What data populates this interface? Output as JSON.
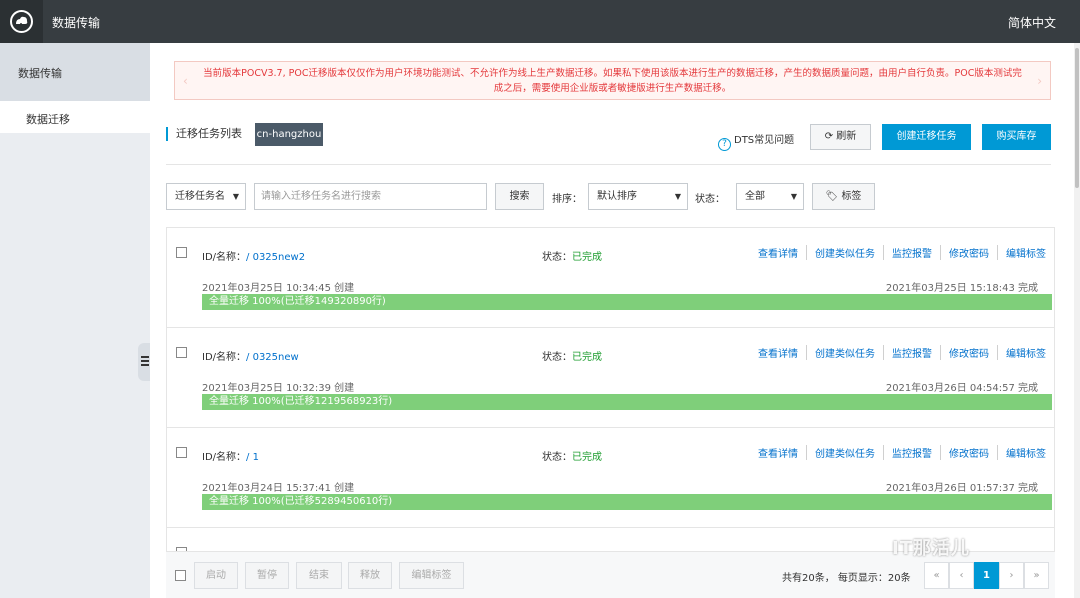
{
  "topbar": {
    "app_title": "数据传输",
    "language": "简体中文",
    "logo_icon": "cloud-logo-icon"
  },
  "sidebar": {
    "section": "数据传输",
    "items": [
      {
        "label": "数据迁移"
      }
    ]
  },
  "notice": {
    "text": "当前版本POCV3.7, POC迁移版本仅仅作为用户环境功能测试、不允许作为线上生产数据迁移。如果私下使用该版本进行生产的数据迁移，产生的数据质量问题，由用户自行负责。POC版本测试完成之后，需要使用企业版或者敏捷版进行生产数据迁移。"
  },
  "header": {
    "list_title": "迁移任务列表",
    "region": "cn-hangzhou",
    "faq": "DTS常见问题",
    "refresh": "刷新",
    "create": "创建迁移任务",
    "buy": "购买库存"
  },
  "filters": {
    "field_select": "迁移任务名",
    "search_placeholder": "请输入迁移任务名进行搜索",
    "search_button": "搜索",
    "sort_label": "排序：",
    "sort_value": "默认排序",
    "status_label": "状态：",
    "status_value": "全部",
    "tag_button": "标签"
  },
  "tasks": [
    {
      "id_label": "ID/名称：",
      "name": "/ 0325new2",
      "status_label": "状态：",
      "status": "已完成",
      "actions": [
        "查看详情",
        "创建类似任务",
        "监控报警",
        "修改密码",
        "编辑标签"
      ],
      "created": "2021年03月25日 10:34:45  创建",
      "done": "2021年03月25日 15:18:43  完成",
      "progress_label": "全量迁移  100%(已迁移149320890行)",
      "progress": 100
    },
    {
      "id_label": "ID/名称：",
      "name": "/ 0325new",
      "status_label": "状态：",
      "status": "已完成",
      "actions": [
        "查看详情",
        "创建类似任务",
        "监控报警",
        "修改密码",
        "编辑标签"
      ],
      "created": "2021年03月25日 10:32:39  创建",
      "done": "2021年03月26日 04:54:57  完成",
      "progress_label": "全量迁移  100%(已迁移1219568923行)",
      "progress": 100
    },
    {
      "id_label": "ID/名称：",
      "name": "/ 1",
      "status_label": "状态：",
      "status": "已完成",
      "actions": [
        "查看详情",
        "创建类似任务",
        "监控报警",
        "修改密码",
        "编辑标签"
      ],
      "created": "2021年03月24日 15:37:41  创建",
      "done": "2021年03月26日 01:57:37  完成",
      "progress_label": "全量迁移  100%(已迁移5289450610行)",
      "progress": 100
    }
  ],
  "footer": {
    "buttons": [
      "启动",
      "暂停",
      "结束",
      "释放",
      "编辑标签"
    ],
    "total": "共有20条，  每页显示：20条",
    "pages": [
      "«",
      "‹",
      "1",
      "›",
      "»"
    ],
    "current_page": "1"
  },
  "watermark": "IT那活儿",
  "colors": {
    "primary": "#0099d5",
    "success": "#1d9d2f",
    "progress": "#7fcf7a",
    "topbar": "#373d41",
    "notice": "#e4393c"
  }
}
